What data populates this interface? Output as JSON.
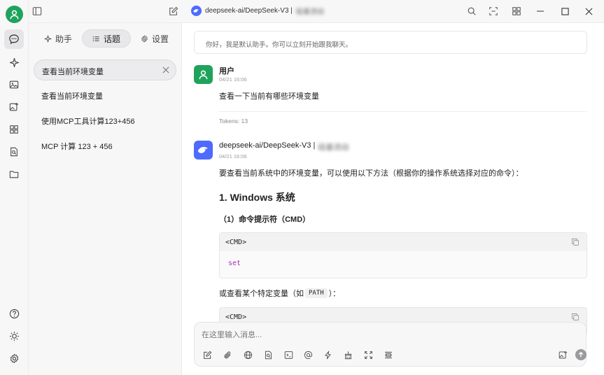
{
  "topbar": {
    "model_name": "deepseek-ai/DeepSeek-V3 |",
    "provider_blurred": "硅基流动"
  },
  "panel": {
    "tabs": [
      {
        "label": "助手",
        "icon": "sparkle-icon"
      },
      {
        "label": "话题",
        "icon": "list-icon"
      },
      {
        "label": "设置",
        "icon": "gear-icon"
      }
    ],
    "selected_topic": "查看当前环境变量",
    "topics": [
      "查看当前环境变量",
      "使用MCP工具计算123+456",
      "MCP 计算 123 + 456"
    ]
  },
  "chat": {
    "greeting": "你好，我是默认助手。你可以立刻开始跟我聊天。",
    "user_name": "用户",
    "user_time": "04/21 16:06",
    "user_message": "查看一下当前有哪些环境变量",
    "tokens": "Tokens: 13",
    "assistant_name": "deepseek-ai/DeepSeek-V3 |",
    "assistant_provider_blurred": "硅基流动",
    "assistant_time": "04/21 16:06",
    "assistant_intro": "要查看当前系统中的环境变量，可以使用以下方法（根据你的操作系统选择对应的命令）：",
    "heading1": "1. Windows 系统",
    "heading2": "（1）命令提示符（CMD）",
    "code1_lang": "<CMD>",
    "code1_body": "set",
    "para2_prefix": "或查看某个特定变量（如",
    "para2_code": "PATH",
    "para2_suffix": "）：",
    "code2_lang": "<CMD>"
  },
  "input": {
    "placeholder": "在这里输入消息..."
  },
  "colors": {
    "accent_green": "#1fa35c",
    "deepseek_blue": "#4d6bfe",
    "code_keyword": "#a034b0"
  }
}
